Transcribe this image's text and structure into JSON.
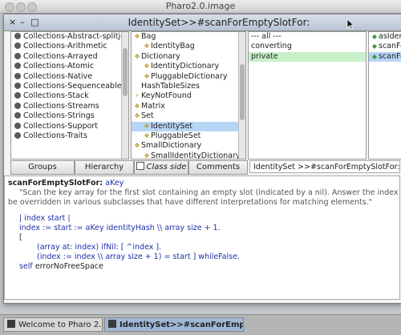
{
  "app": {
    "outer_title": "Pharo2.0.image"
  },
  "window": {
    "title": "IdentitySet>>#scanForEmptySlotFor:",
    "close": "×",
    "collapse": "–",
    "expand": "□"
  },
  "packages": [
    "Collections-Abstract-splitjoin",
    "Collections-Arithmetic",
    "Collections-Arrayed",
    "Collections-Atomic",
    "Collections-Native",
    "Collections-Sequenceable",
    "Collections-Stack",
    "Collections-Streams",
    "Collections-Strings",
    "Collections-Support",
    "Collections-Traits"
  ],
  "classes": [
    {
      "name": "Bag",
      "icon": "package-icon"
    },
    {
      "name": "IdentityBag",
      "icon": "package-icon"
    },
    {
      "name": "Dictionary",
      "icon": "package-icon"
    },
    {
      "name": "IdentityDictionary",
      "icon": "package-icon"
    },
    {
      "name": "PluggableDictionary",
      "icon": "package-icon"
    },
    {
      "name": "HashTableSizes",
      "icon": ""
    },
    {
      "name": "KeyNotFound",
      "icon": "lightning-icon"
    },
    {
      "name": "Matrix",
      "icon": "package-icon"
    },
    {
      "name": "Set",
      "icon": "package-icon"
    },
    {
      "name": "IdentitySet",
      "icon": "package-icon"
    },
    {
      "name": "PluggableSet",
      "icon": "package-icon"
    },
    {
      "name": "SmallDictionary",
      "icon": "package-icon"
    },
    {
      "name": "SmallIdentityDictionary",
      "icon": "package-icon"
    }
  ],
  "protocols": [
    "--- all ---",
    "converting",
    "private"
  ],
  "methods": [
    "asIdent",
    "scanFor",
    "scanFor"
  ],
  "buttons": {
    "groups": "Groups",
    "hierarchy": "Hierarchy",
    "class_side": "Class side",
    "comments": "Comments"
  },
  "method_field": "IdentitySet >>#scanForEmptySlotFor:",
  "code": {
    "l1a": "scanForEmptySlotFor: ",
    "l1b": "aKey",
    "l2": "\"Scan the key array for the first slot containing an empty slot (indicated by a nil). Answer the index of that slo",
    "l3": "be overridden in various subclasses that have different interpretations for matching elements.\"",
    "l4": "| index start |",
    "l5": "index := start := aKey identityHash \\\\ array size + 1.",
    "l6": "[",
    "l7": "(array at: index) ifNil: [ ^index ].",
    "l8": "(index := index \\\\ array size + 1) = start ] whileFalse.",
    "l9a": "self ",
    "l9b": "errorNoFreeSpace"
  },
  "taskbar": {
    "t1": "Welcome to Pharo 2.0",
    "t2": "IdentitySet>>#scanForEmptyS..."
  },
  "colors": {
    "selection": "#b7d5f5",
    "protocol_selected": "#c8f0c8",
    "keyword": "#1f2fa8"
  }
}
